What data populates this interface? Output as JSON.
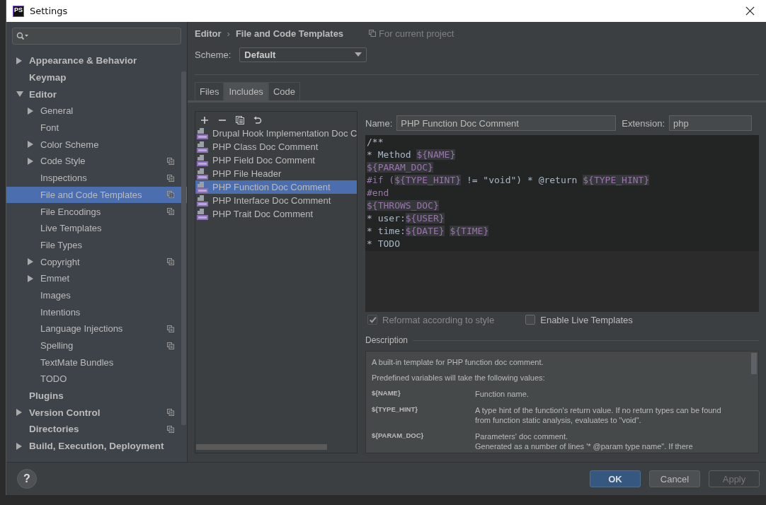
{
  "window": {
    "title": "Settings",
    "app_icon_text": "PS"
  },
  "sidebar": {
    "items": [
      {
        "label": "Appearance & Behavior",
        "expandable": true,
        "expanded": false,
        "selected": false,
        "project_scope": false
      },
      {
        "label": "Keymap",
        "expandable": false,
        "selected": false,
        "project_scope": false
      },
      {
        "label": "Editor",
        "expandable": true,
        "expanded": true,
        "selected": false,
        "project_scope": false,
        "children": [
          {
            "label": "General",
            "expandable": true,
            "expanded": false,
            "selected": false,
            "project_scope": false
          },
          {
            "label": "Font",
            "expandable": false,
            "selected": false,
            "project_scope": false
          },
          {
            "label": "Color Scheme",
            "expandable": true,
            "expanded": false,
            "selected": false,
            "project_scope": false
          },
          {
            "label": "Code Style",
            "expandable": true,
            "expanded": false,
            "selected": false,
            "project_scope": true
          },
          {
            "label": "Inspections",
            "expandable": false,
            "selected": false,
            "project_scope": true
          },
          {
            "label": "File and Code Templates",
            "expandable": false,
            "selected": true,
            "project_scope": true
          },
          {
            "label": "File Encodings",
            "expandable": false,
            "selected": false,
            "project_scope": true
          },
          {
            "label": "Live Templates",
            "expandable": false,
            "selected": false,
            "project_scope": false
          },
          {
            "label": "File Types",
            "expandable": false,
            "selected": false,
            "project_scope": false
          },
          {
            "label": "Copyright",
            "expandable": true,
            "expanded": false,
            "selected": false,
            "project_scope": true
          },
          {
            "label": "Emmet",
            "expandable": true,
            "expanded": false,
            "selected": false,
            "project_scope": false
          },
          {
            "label": "Images",
            "expandable": false,
            "selected": false,
            "project_scope": false
          },
          {
            "label": "Intentions",
            "expandable": false,
            "selected": false,
            "project_scope": false
          },
          {
            "label": "Language Injections",
            "expandable": false,
            "selected": false,
            "project_scope": true
          },
          {
            "label": "Spelling",
            "expandable": false,
            "selected": false,
            "project_scope": true
          },
          {
            "label": "TextMate Bundles",
            "expandable": false,
            "selected": false,
            "project_scope": false
          },
          {
            "label": "TODO",
            "expandable": false,
            "selected": false,
            "project_scope": false
          }
        ]
      },
      {
        "label": "Plugins",
        "expandable": false,
        "selected": false,
        "project_scope": false
      },
      {
        "label": "Version Control",
        "expandable": true,
        "expanded": false,
        "selected": false,
        "project_scope": true
      },
      {
        "label": "Directories",
        "expandable": false,
        "selected": false,
        "project_scope": true
      },
      {
        "label": "Build, Execution, Deployment",
        "expandable": true,
        "expanded": false,
        "selected": false,
        "project_scope": false
      }
    ]
  },
  "breadcrumb": {
    "parent": "Editor",
    "separator": "›",
    "current": "File and Code Templates",
    "scope_note": "For current project"
  },
  "scheme": {
    "label": "Scheme:",
    "value": "Default"
  },
  "tabs": [
    {
      "label": "Files",
      "selected": false
    },
    {
      "label": "Includes",
      "selected": true
    },
    {
      "label": "Code",
      "selected": false
    }
  ],
  "toolbar": [
    {
      "kind": "add"
    },
    {
      "kind": "remove"
    },
    {
      "kind": "copy"
    },
    {
      "kind": "reset"
    }
  ],
  "templates": [
    {
      "label": "Drupal Hook Implementation Doc C",
      "selected": false
    },
    {
      "label": "PHP Class Doc Comment",
      "selected": false
    },
    {
      "label": "PHP Field Doc Comment",
      "selected": false
    },
    {
      "label": "PHP File Header",
      "selected": false
    },
    {
      "label": "PHP Function Doc Comment",
      "selected": true
    },
    {
      "label": "PHP Interface Doc Comment",
      "selected": false
    },
    {
      "label": "PHP Trait Doc Comment",
      "selected": false
    }
  ],
  "name_field": {
    "label": "Name:",
    "value": "PHP Function Doc Comment"
  },
  "extension_field": {
    "label": "Extension:",
    "value": "php"
  },
  "code": [
    [
      {
        "text": "/**",
        "kind": "plain"
      }
    ],
    [
      {
        "text": "* Method ",
        "kind": "plain"
      },
      {
        "text": "${NAME}",
        "kind": "var"
      }
    ],
    [
      {
        "text": "${PARAM_DOC}",
        "kind": "var"
      }
    ],
    [
      {
        "text": "#if (",
        "kind": "directive"
      },
      {
        "text": "${TYPE_HINT}",
        "kind": "var"
      },
      {
        "text": " != \"void\") * @return ",
        "kind": "plain"
      },
      {
        "text": "${TYPE_HINT}",
        "kind": "var"
      }
    ],
    [
      {
        "text": "#end",
        "kind": "directive"
      }
    ],
    [
      {
        "text": "${THROWS_DOC}",
        "kind": "var"
      }
    ],
    [
      {
        "text": "* user:",
        "kind": "plain"
      },
      {
        "text": "${USER}",
        "kind": "var"
      }
    ],
    [
      {
        "text": "* time:",
        "kind": "plain"
      },
      {
        "text": "${DATE}",
        "kind": "var"
      },
      {
        "text": " ${TIME}",
        "kind": "var"
      }
    ],
    [
      {
        "text": "* TODO",
        "kind": "plain"
      }
    ]
  ],
  "options": [
    {
      "label": "Reformat according to style",
      "checked": true,
      "disabled": true
    },
    {
      "label": "Enable Live Templates",
      "checked": false,
      "disabled": false
    }
  ],
  "description": {
    "title": "Description",
    "intro": "A built-in template for PHP function doc comment.",
    "lead": "Predefined variables will take the following values:",
    "variables": [
      {
        "name": "${NAME}",
        "text": "Function name."
      },
      {
        "name": "${TYPE_HINT}",
        "text": "A type hint of the function's return value. If no return types can be found from function static analysis, evaluates to \"void\"."
      },
      {
        "name": "${PARAM_DOC}",
        "text": "Parameters' doc comment.\nGenerated as a number of lines '* @param type name\". If there"
      }
    ]
  },
  "buttons": [
    {
      "label": "OK",
      "kind": "primary",
      "disabled": false
    },
    {
      "label": "Cancel",
      "kind": "normal",
      "disabled": false
    },
    {
      "label": "Apply",
      "kind": "normal",
      "disabled": true
    }
  ],
  "help": {
    "label": "?"
  }
}
